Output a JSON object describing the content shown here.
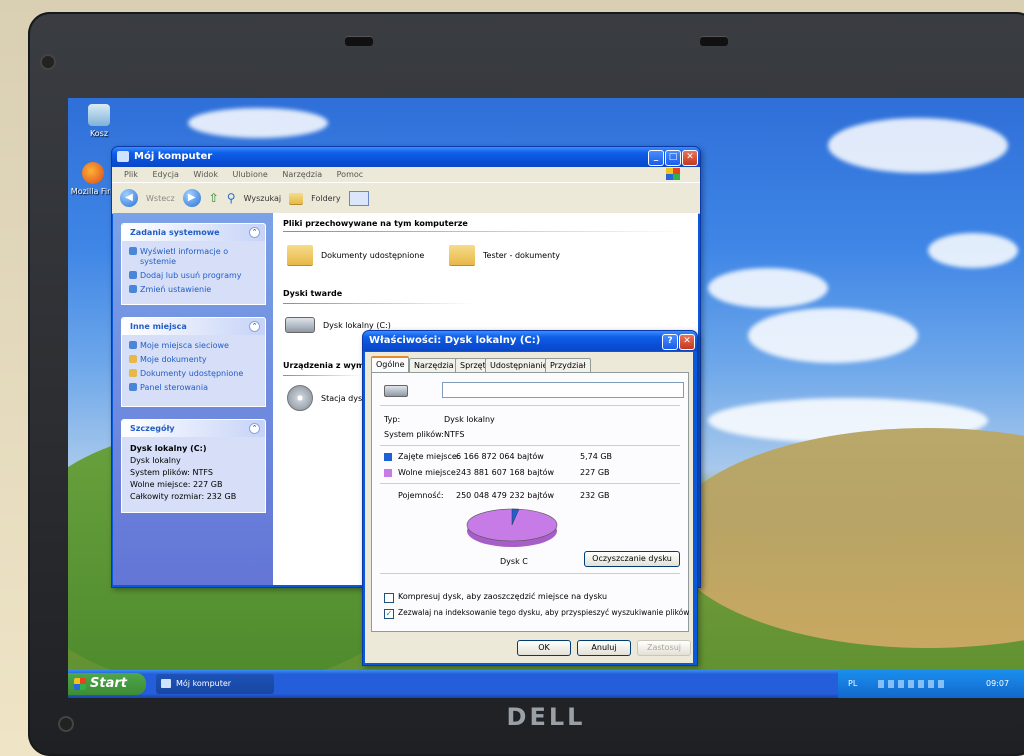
{
  "desktop": {
    "icons": [
      {
        "label": "Kosz",
        "icon": "recycle-bin-icon"
      },
      {
        "label": "Mozilla Fire",
        "icon": "firefox-icon"
      }
    ]
  },
  "explorer": {
    "title": "Mój komputer",
    "menu": [
      "Plik",
      "Edycja",
      "Widok",
      "Ulubione",
      "Narzędzia",
      "Pomoc"
    ],
    "toolbar": {
      "back": "Wstecz",
      "search": "Wyszukaj",
      "folders": "Foldery"
    },
    "tasks": {
      "title": "Zadania systemowe",
      "items": [
        "Wyświetl informacje o systemie",
        "Dodaj lub usuń programy",
        "Zmień ustawienie"
      ]
    },
    "places": {
      "title": "Inne miejsca",
      "items": [
        "Moje miejsca sieciowe",
        "Moje dokumenty",
        "Dokumenty udostępnione",
        "Panel sterowania"
      ]
    },
    "details": {
      "title": "Szczegóły",
      "name": "Dysk lokalny (C:)",
      "type": "Dysk lokalny",
      "fs": "System plików: NTFS",
      "free": "Wolne miejsce: 227 GB",
      "total": "Całkowity rozmiar: 232 GB"
    },
    "sections": {
      "files": "Pliki przechowywane na tym komputerze",
      "drives": "Dyski twarde",
      "devices": "Urządzenia z wym"
    },
    "items": {
      "shared_docs": "Dokumenty udostępnione",
      "tester_docs": "Tester - dokumenty",
      "local_disk": "Dysk lokalny (C:)",
      "cd_drive": "Stacja dys"
    }
  },
  "properties": {
    "title": "Właściwości: Dysk lokalny (C:)",
    "tabs": [
      "Ogólne",
      "Narzędzia",
      "Sprzęt",
      "Udostępnianie",
      "Przydział"
    ],
    "name_value": "",
    "type_label": "Typ:",
    "type_value": "Dysk lokalny",
    "fs_label": "System plików:",
    "fs_value": "NTFS",
    "used_label": "Zajęte miejsce:",
    "used_bytes": "6 166 872 064 bajtów",
    "used_gb": "5,74 GB",
    "free_label": "Wolne miejsce:",
    "free_bytes": "243 881 607 168 bajtów",
    "free_gb": "227 GB",
    "capacity_label": "Pojemność:",
    "capacity_bytes": "250 048 479 232 bajtów",
    "capacity_gb": "232 GB",
    "disk_label": "Dysk C",
    "cleanup_button": "Oczyszczanie dysku",
    "compress_label": "Kompresuj dysk, aby zaoszczędzić miejsce na dysku",
    "compress_checked": false,
    "index_label": "Zezwalaj na indeksowanie tego dysku, aby przyspieszyć wyszukiwanie plików",
    "index_checked": true,
    "ok": "OK",
    "cancel": "Anuluj",
    "apply": "Zastosuj",
    "used_fraction": 0.0247,
    "colors": {
      "used": "#1f5fd6",
      "free": "#c77be6"
    }
  },
  "taskbar": {
    "start": "Start",
    "window_button": "Mój komputer",
    "lang": "PL",
    "clock": "09:07"
  },
  "laptop": {
    "brand": "DELL"
  }
}
